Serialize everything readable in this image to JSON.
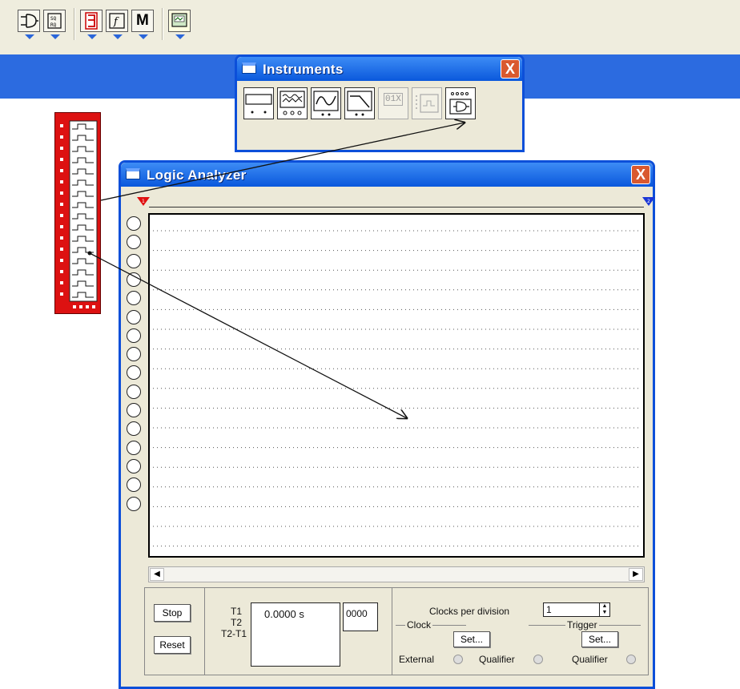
{
  "toolbar": {
    "buttons": [
      {
        "name": "gate-icon"
      },
      {
        "name": "flipflop-icon"
      },
      {
        "name": "seven-segment-icon"
      },
      {
        "name": "function-icon"
      },
      {
        "name": "mixed-icon",
        "label": "M"
      },
      {
        "name": "instruments-icon"
      }
    ]
  },
  "instruments_window": {
    "title": "Instruments",
    "close_label": "X",
    "word_generator_label": "01X"
  },
  "logic_analyzer": {
    "title": "Logic Analyzer",
    "trigger_marker_1": "1",
    "trigger_marker_2": "2",
    "buttons": {
      "stop": "Stop",
      "reset": "Reset"
    },
    "readout": {
      "t1_label": "T1",
      "t2_label": "T2",
      "t2t1_label": "T2-T1",
      "time_value": "0.0000 s",
      "hex_value": "0000"
    },
    "clock": {
      "clocks_per_division_label": "Clocks per division",
      "clocks_per_division_value": "1",
      "clock_group": "Clock",
      "set_label": "Set...",
      "external_label": "External",
      "qualifier_label": "Qualifier"
    },
    "trigger": {
      "group": "Trigger",
      "set_label": "Set...",
      "qualifier_label": "Qualifier"
    }
  },
  "colors": {
    "titlebar": "#0a58dc",
    "toolbar_bg": "#efedde",
    "chip_red": "#dd1111",
    "close_red": "#d9592f"
  }
}
